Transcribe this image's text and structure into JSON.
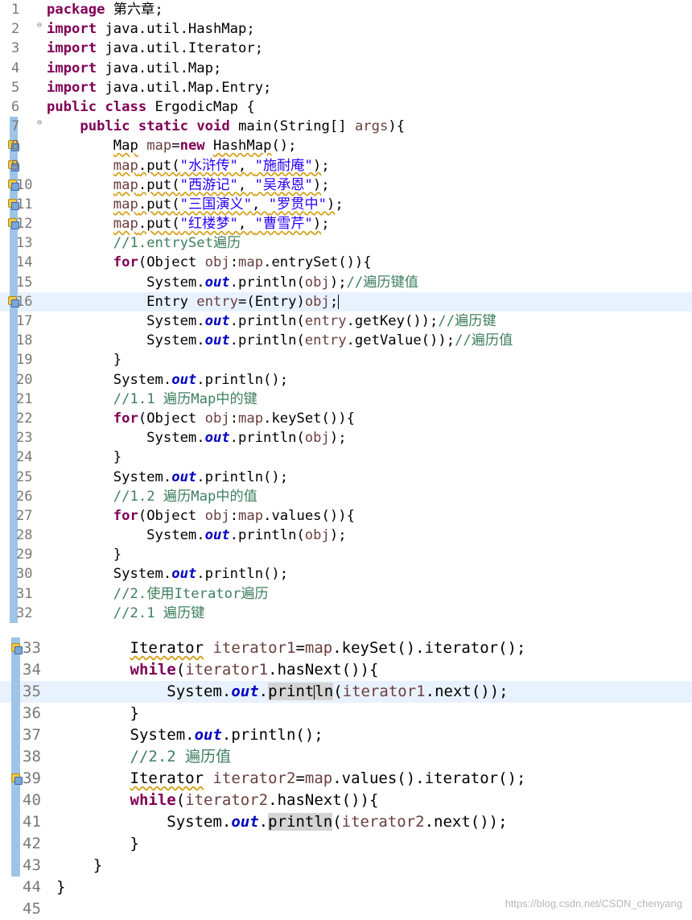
{
  "editor": {
    "lines_part1": [
      {
        "n": "1",
        "html": "<span class='kw'>package</span> 第六章;"
      },
      {
        "n": "2",
        "html": "<span class='kw'>import</span> java.util.HashMap;",
        "fold": true
      },
      {
        "n": "3",
        "html": "<span class='kw'>import</span> java.util.Iterator;"
      },
      {
        "n": "4",
        "html": "<span class='kw'>import</span> java.util.Map;"
      },
      {
        "n": "5",
        "html": "<span class='kw'>import</span> java.util.Map.Entry;"
      },
      {
        "n": "6",
        "html": "<span class='kw'>public</span> <span class='kw'>class</span> ErgodicMap {"
      },
      {
        "n": "7",
        "html": "    <span class='kw'>public</span> <span class='kw'>static</span> <span class='kw'>void</span> main(String[] <span class='var'>args</span>){",
        "fold": true,
        "gutter": true
      },
      {
        "n": "8",
        "html": "        <span class='sq'>Map</span> <span class='var'>map</span>=<span class='kw'>new</span> <span class='sq'>HashMap</span>();",
        "gutter": true,
        "warn": true
      },
      {
        "n": "9",
        "html": "        <span class='sq'><span class='var'>map</span>.put(<span class='st'>\"水浒传\"</span>, <span class='st'>\"施耐庵\"</span>)</span>;",
        "gutter": true,
        "warn": true
      },
      {
        "n": "10",
        "html": "        <span class='sq'><span class='var'>map</span>.put(<span class='st'>\"西游记\"</span>, <span class='st'>\"吴承恩\"</span>)</span>;",
        "gutter": true,
        "warn": true
      },
      {
        "n": "11",
        "html": "        <span class='sq'><span class='var'>map</span>.put(<span class='st'>\"三国演义\"</span>, <span class='st'>\"罗贯中\"</span>)</span>;",
        "gutter": true,
        "warn": true
      },
      {
        "n": "12",
        "html": "        <span class='sq'><span class='var'>map</span>.put(<span class='st'>\"红楼梦\"</span>, <span class='st'>\"曹雪芹\"</span>)</span>;",
        "gutter": true,
        "warn": true
      },
      {
        "n": "13",
        "html": "        <span class='cm'>//1.entrySet遍历</span>",
        "gutter": true
      },
      {
        "n": "14",
        "html": "        <span class='kw'>for</span>(Object <span class='var'>obj</span>:<span class='var'>map</span>.entrySet()){",
        "gutter": true
      },
      {
        "n": "15",
        "html": "            System.<span class='fld'>out</span>.println(<span class='var'>obj</span>);<span class='cm'>//遍历键值</span>",
        "gutter": true
      },
      {
        "n": "16",
        "html": "            Entry <span class='var'>entry</span>=(Entry)<span class='var'>obj</span>;<span class='cursor'></span>",
        "gutter": true,
        "warn": true,
        "hl": true
      },
      {
        "n": "17",
        "html": "            System.<span class='fld'>out</span>.println(<span class='var'>entry</span>.getKey());<span class='cm'>//遍历键</span>",
        "gutter": true
      },
      {
        "n": "18",
        "html": "            System.<span class='fld'>out</span>.println(<span class='var'>entry</span>.getValue());<span class='cm'>//遍历值</span>",
        "gutter": true
      },
      {
        "n": "19",
        "html": "        }",
        "gutter": true
      },
      {
        "n": "20",
        "html": "        System.<span class='fld'>out</span>.println();",
        "gutter": true
      },
      {
        "n": "21",
        "html": "        <span class='cm'>//1.1 遍历Map中的键</span>",
        "gutter": true
      },
      {
        "n": "22",
        "html": "        <span class='kw'>for</span>(Object <span class='var'>obj</span>:<span class='var'>map</span>.keySet()){",
        "gutter": true
      },
      {
        "n": "23",
        "html": "            System.<span class='fld'>out</span>.println(<span class='var'>obj</span>);",
        "gutter": true
      },
      {
        "n": "24",
        "html": "        }",
        "gutter": true
      },
      {
        "n": "25",
        "html": "        System.<span class='fld'>out</span>.println();",
        "gutter": true
      },
      {
        "n": "26",
        "html": "        <span class='cm'>//1.2 遍历Map中的值</span>",
        "gutter": true
      },
      {
        "n": "27",
        "html": "        <span class='kw'>for</span>(Object <span class='var'>obj</span>:<span class='var'>map</span>.values()){",
        "gutter": true
      },
      {
        "n": "28",
        "html": "            System.<span class='fld'>out</span>.println(<span class='var'>obj</span>);",
        "gutter": true
      },
      {
        "n": "29",
        "html": "        }",
        "gutter": true
      },
      {
        "n": "30",
        "html": "        System.<span class='fld'>out</span>.println();",
        "gutter": true
      },
      {
        "n": "31",
        "html": "        <span class='cm'>//2.使用Iterator遍历</span>",
        "gutter": true
      },
      {
        "n": "32",
        "html": "        <span class='cm'>//2.1 遍历键</span>",
        "gutter": true
      }
    ],
    "lines_part2": [
      {
        "n": "33",
        "html": "        <span class='sq'>Iterator</span> <span class='var'>iterator1</span>=<span class='var'>map</span>.keySet().iterator();",
        "warn": true
      },
      {
        "n": "34",
        "html": "        <span class='kw'>while</span>(<span class='var'>iterator1</span>.hasNext()){"
      },
      {
        "n": "35",
        "html": "            System.<span class='fld'>out</span>.<span class='mark'>print<span class='cursor'></span>ln</span>(<span class='var'>iterator1</span>.next());",
        "hl": true
      },
      {
        "n": "36",
        "html": "        }"
      },
      {
        "n": "37",
        "html": "        System.<span class='fld'>out</span>.println();"
      },
      {
        "n": "38",
        "html": "        <span class='cm'>//2.2 遍历值</span>"
      },
      {
        "n": "39",
        "html": "        <span class='sq'>Iterator</span> <span class='var'>iterator2</span>=<span class='var'>map</span>.values().iterator();",
        "warn": true
      },
      {
        "n": "40",
        "html": "        <span class='kw'>while</span>(<span class='var'>iterator2</span>.hasNext()){"
      },
      {
        "n": "41",
        "html": "            System.<span class='fld'>out</span>.<span class='mark'>println</span>(<span class='var'>iterator2</span>.next());"
      },
      {
        "n": "42",
        "html": "        }"
      },
      {
        "n": "43",
        "html": "    }"
      },
      {
        "n": "44",
        "html": "}",
        "nogutter": true
      },
      {
        "n": "45",
        "html": "",
        "nogutter": true
      }
    ]
  },
  "watermark": "https://blog.csdn.net/CSDN_chenyang"
}
